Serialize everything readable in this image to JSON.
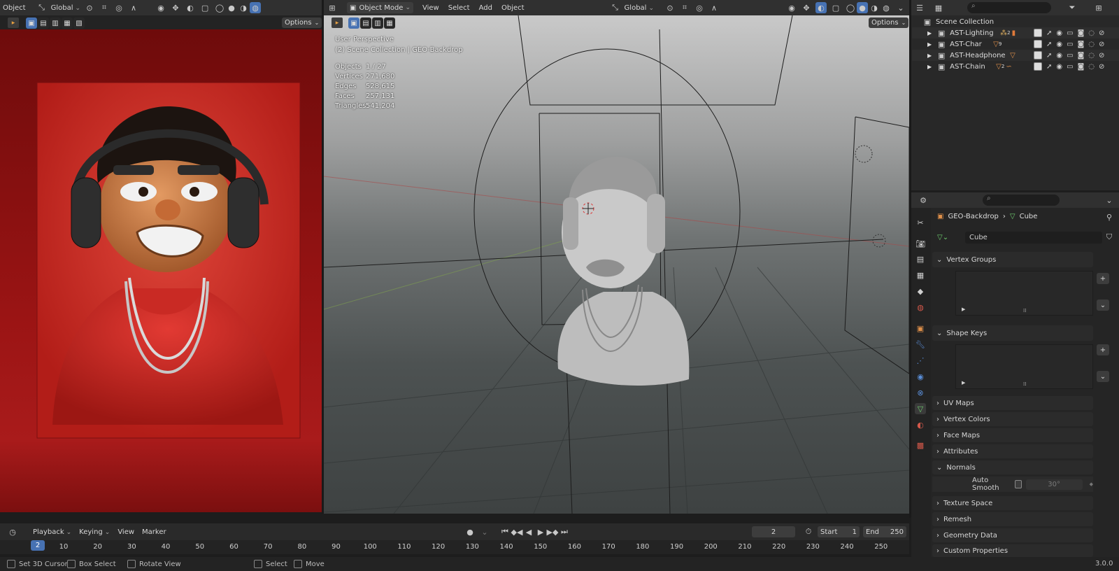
{
  "left_header": {
    "mode_label": "Object",
    "orientation": "Global",
    "options": "Options"
  },
  "viewport_header": {
    "mode": "Object Mode",
    "menus": [
      "View",
      "Select",
      "Add",
      "Object"
    ],
    "orientation": "Global",
    "options": "Options"
  },
  "viewport_overlay": {
    "perspective": "User Perspective",
    "context": "(2) Scene Collection | GEO-Backdrop",
    "stats": [
      {
        "label": "Objects",
        "value": "1 / 27"
      },
      {
        "label": "Vertices",
        "value": "271,680"
      },
      {
        "label": "Edges",
        "value": "528,615"
      },
      {
        "label": "Faces",
        "value": "257,131"
      },
      {
        "label": "Triangles",
        "value": "541,204"
      }
    ]
  },
  "outliner": {
    "root": "Scene Collection",
    "items": [
      {
        "name": "AST-Lighting",
        "badge": "2"
      },
      {
        "name": "AST-Char",
        "badge": "9"
      },
      {
        "name": "AST-Headphone",
        "badge": ""
      },
      {
        "name": "AST-Chain",
        "badge": "2"
      }
    ]
  },
  "properties": {
    "breadcrumb_object": "GEO-Backdrop",
    "breadcrumb_data": "Cube",
    "data_name": "Cube",
    "panels": {
      "vertex_groups": "Vertex Groups",
      "shape_keys": "Shape Keys",
      "uv_maps": "UV Maps",
      "vertex_colors": "Vertex Colors",
      "face_maps": "Face Maps",
      "attributes": "Attributes",
      "normals": "Normals",
      "auto_smooth": "Auto Smooth",
      "auto_smooth_angle": "30°",
      "texture_space": "Texture Space",
      "remesh": "Remesh",
      "geometry_data": "Geometry Data",
      "custom_properties": "Custom Properties"
    }
  },
  "timeline": {
    "menus": [
      "Playback",
      "Keying",
      "View",
      "Marker"
    ],
    "current_frame": "2",
    "start_label": "Start",
    "start": "1",
    "end_label": "End",
    "end": "250",
    "ticks": [
      "10",
      "20",
      "30",
      "40",
      "50",
      "60",
      "70",
      "80",
      "90",
      "100",
      "110",
      "120",
      "130",
      "140",
      "150",
      "160",
      "170",
      "180",
      "190",
      "200",
      "210",
      "220",
      "230",
      "240",
      "250"
    ]
  },
  "statusbar": {
    "items": [
      "Set 3D Cursor",
      "Box Select",
      "Rotate View",
      "Select",
      "Move"
    ],
    "version": "3.0.0"
  },
  "colors": {
    "accent": "#4772b3",
    "header": "#303030",
    "panel": "#2b2b2b",
    "reference_red": "#c8281e"
  }
}
